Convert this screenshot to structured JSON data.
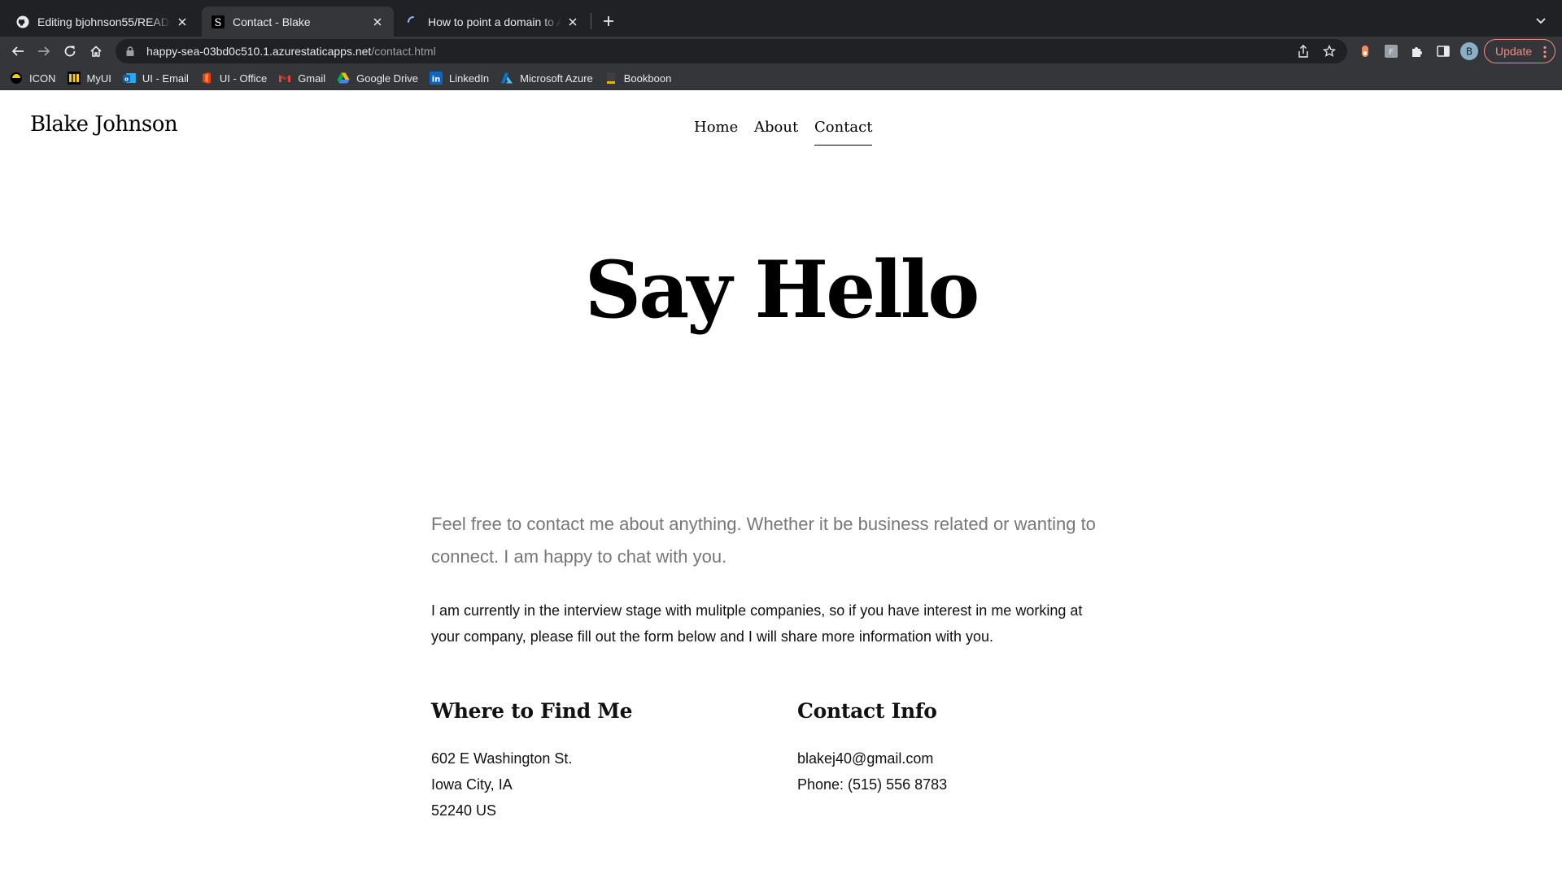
{
  "browser": {
    "tabs": [
      {
        "title": "Editing bjohnson55/README.md",
        "favicon": "github-icon",
        "active": false
      },
      {
        "title": "Contact - Blake",
        "favicon": "squarespace-s-icon",
        "active": true
      },
      {
        "title": "How to point a domain to Azure",
        "favicon": "loading-spinner-icon",
        "active": false
      }
    ],
    "url_host": "happy-sea-03bd0c510.1.azurestaticapps.net",
    "url_path": "/contact.html",
    "update_label": "Update",
    "profile_initial": "B",
    "bookmarks": [
      {
        "label": "ICON",
        "icon": "icon-bookmark-icon"
      },
      {
        "label": "MyUI",
        "icon": "myui-icon"
      },
      {
        "label": "UI - Email",
        "icon": "outlook-icon"
      },
      {
        "label": "UI - Office",
        "icon": "office-icon"
      },
      {
        "label": "Gmail",
        "icon": "gmail-icon"
      },
      {
        "label": "Google Drive",
        "icon": "google-drive-icon"
      },
      {
        "label": "LinkedIn",
        "icon": "linkedin-icon"
      },
      {
        "label": "Microsoft Azure",
        "icon": "azure-icon"
      },
      {
        "label": "Bookboon",
        "icon": "bookboon-icon"
      }
    ]
  },
  "site": {
    "title": "Blake Johnson",
    "nav": [
      {
        "label": "Home",
        "active": false
      },
      {
        "label": "About",
        "active": false
      },
      {
        "label": "Contact",
        "active": true
      }
    ]
  },
  "page": {
    "hero": "Say Hello",
    "lead_line1": "Feel free to contact me about anything. Whether it be business related or wanting to",
    "lead_line2": "connect. I am happy to chat with you.",
    "para_line1": "I am currently in the interview stage with mulitple companies, so if you have interest in me working at",
    "para_line2": "your company, please fill out the form below and I will share more information with you.",
    "location": {
      "heading": "Where to Find Me",
      "lines": [
        "602 E Washington St.",
        "Iowa City, IA",
        "52240 US"
      ]
    },
    "contact": {
      "heading": "Contact Info",
      "email": "blakej40@gmail.com",
      "phone": "Phone: (515) 556 8783"
    }
  },
  "colors": {
    "chrome_dark": "#202124",
    "chrome_toolbar": "#35363a",
    "update_accent": "#f28b82",
    "lead_gray": "#777777"
  }
}
